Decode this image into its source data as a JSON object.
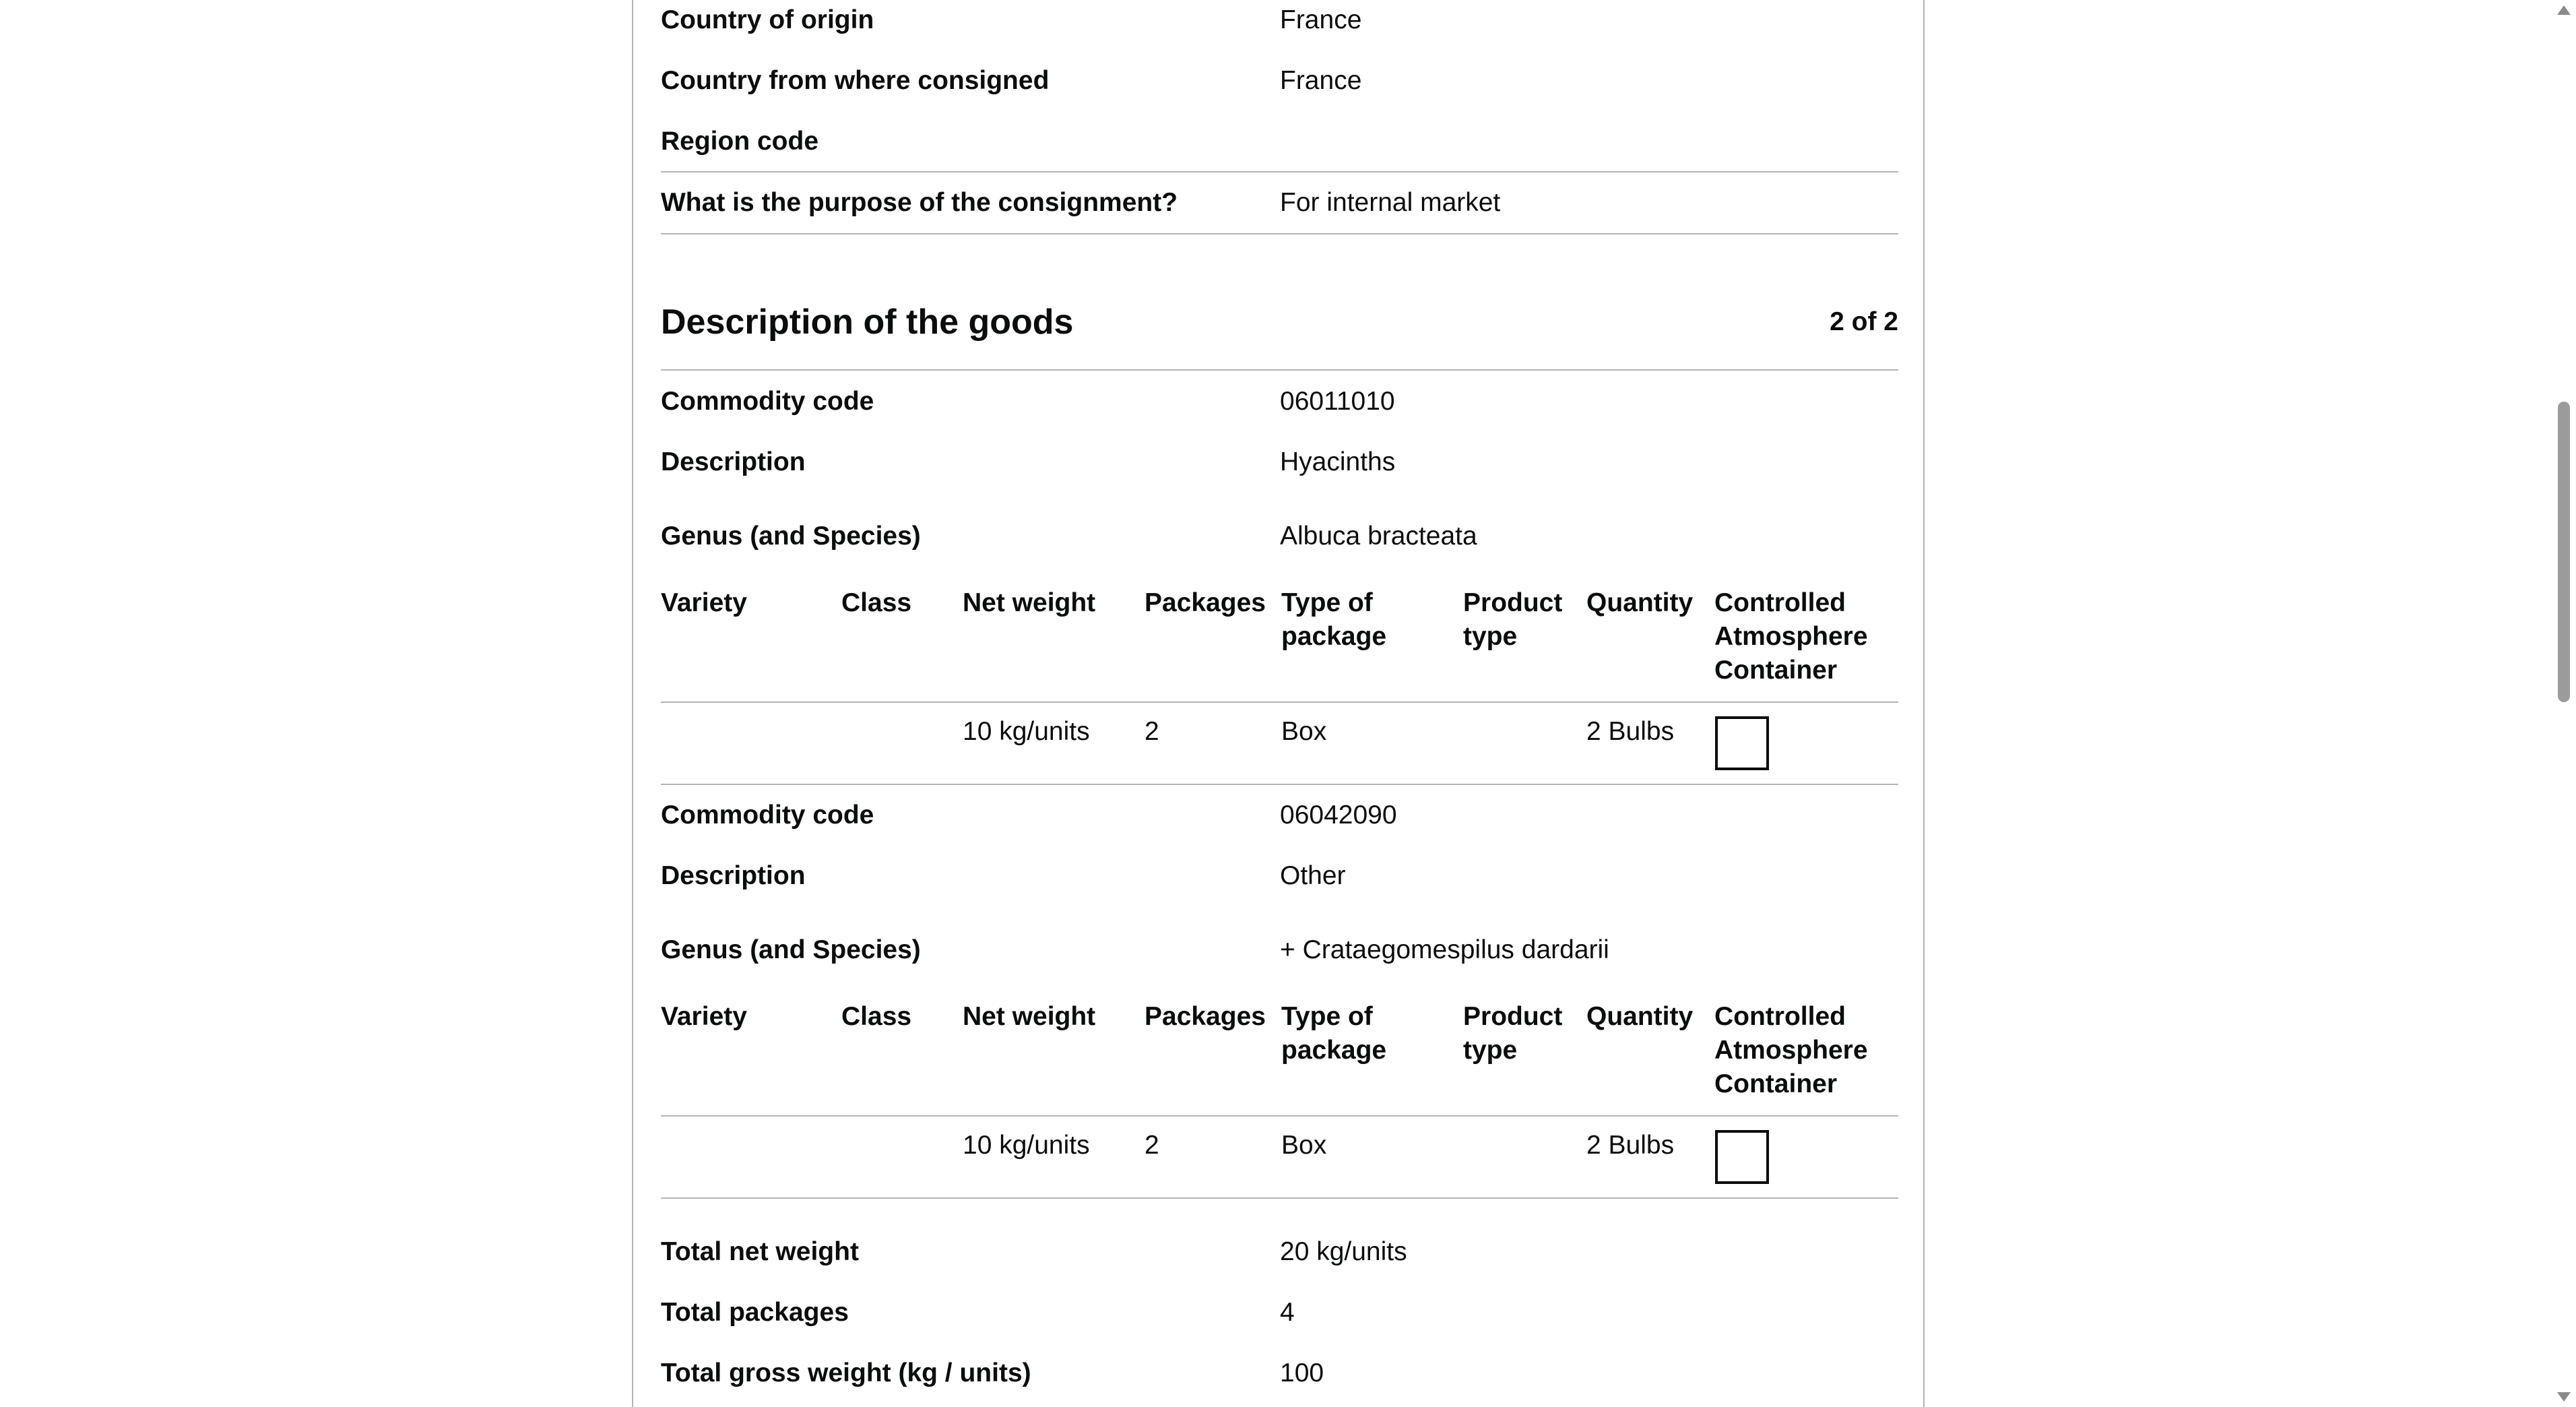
{
  "origin": {
    "country_of_origin_label": "Country of origin",
    "country_of_origin_value": "France",
    "consigned_from_label": "Country from where consigned",
    "consigned_from_value": "France",
    "region_code_label": "Region code",
    "region_code_value": "",
    "purpose_label": "What is the purpose of the consignment?",
    "purpose_value": "For internal market"
  },
  "goods": {
    "heading": "Description of the goods",
    "count": "2 of 2",
    "table_headers": {
      "variety": "Variety",
      "class": "Class",
      "net_weight": "Net weight",
      "packages": "Packages",
      "type_of_package": "Type of package",
      "product_type": "Product type",
      "quantity": "Quantity",
      "controlled_atmosphere": "Controlled Atmosphere Container"
    },
    "commodity_code_label": "Commodity code",
    "description_label": "Description",
    "genus_label": "Genus (and Species)",
    "items": [
      {
        "commodity_code": "06011010",
        "description": "Hyacinths",
        "genus": "Albuca bracteata",
        "row": {
          "variety": "",
          "class": "",
          "net_weight": "10 kg/units",
          "packages": "2",
          "type_of_package": "Box",
          "product_type": "",
          "quantity": "2 Bulbs",
          "controlled_atmosphere_checked": false
        }
      },
      {
        "commodity_code": "06042090",
        "description": "Other",
        "genus": "+ Crataegomespilus dardarii",
        "row": {
          "variety": "",
          "class": "",
          "net_weight": "10 kg/units",
          "packages": "2",
          "type_of_package": "Box",
          "product_type": "",
          "quantity": "2 Bulbs",
          "controlled_atmosphere_checked": false
        }
      }
    ]
  },
  "totals": {
    "net_weight_label": "Total net weight",
    "net_weight_value": "20 kg/units",
    "packages_label": "Total packages",
    "packages_value": "4",
    "gross_weight_label": "Total gross weight (kg / units)",
    "gross_weight_value": "100"
  }
}
